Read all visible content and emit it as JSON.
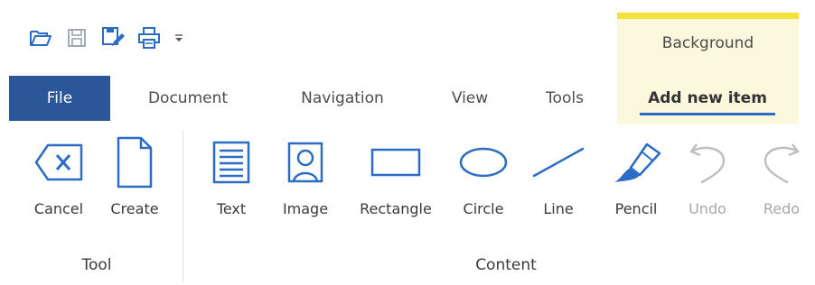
{
  "quick_access": {
    "icons": [
      "open-folder-icon",
      "save-icon",
      "save-as-icon",
      "print-icon",
      "customize-dropdown-icon"
    ]
  },
  "contextual": {
    "title": "Background",
    "accent": "#f5e13a",
    "fill": "#fcf8de"
  },
  "tabs": {
    "file": "File",
    "document": "Document",
    "navigation": "Navigation",
    "view": "View",
    "tools": "Tools",
    "add_new_item": "Add new item"
  },
  "groups": {
    "tool": {
      "label": "Tool",
      "items": {
        "cancel": "Cancel",
        "create": "Create"
      }
    },
    "content": {
      "label": "Content",
      "items": {
        "text": "Text",
        "image": "Image",
        "rectangle": "Rectangle",
        "circle": "Circle",
        "line": "Line",
        "pencil": "Pencil",
        "undo": "Undo",
        "redo": "Redo"
      }
    }
  },
  "colors": {
    "accent_blue": "#2b579a",
    "icon_blue": "#2b6cc4",
    "disabled": "#b8b8b8"
  }
}
